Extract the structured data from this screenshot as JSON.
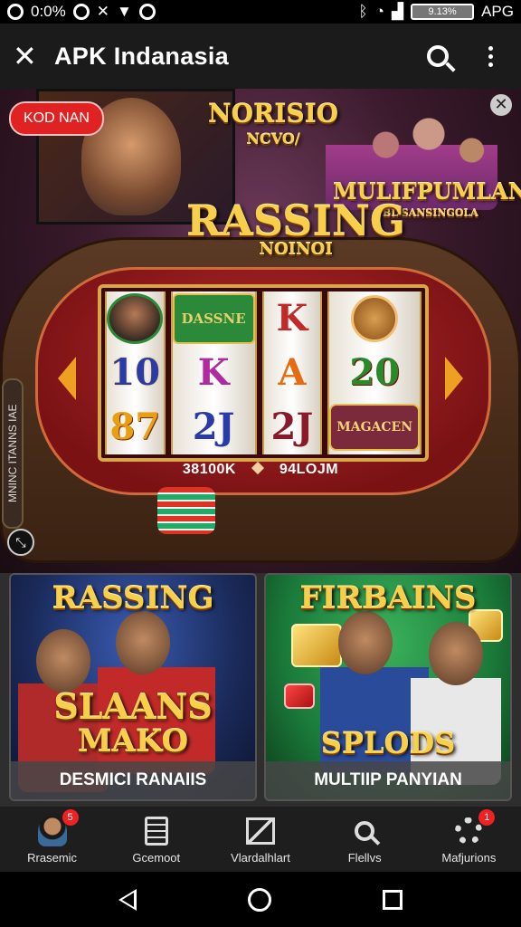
{
  "status_bar": {
    "left_text": "0:0%",
    "battery": "9.13%",
    "carrier": "APG"
  },
  "app_bar": {
    "title": "APK Indanasia",
    "icons": [
      "close-icon",
      "search-icon",
      "more-vert-icon"
    ]
  },
  "hero": {
    "badge": "KOD NAN",
    "logo_top": "NORISIO",
    "logo_top_sub": "NCVO/",
    "logo_right": "MULIFPUMLAN",
    "logo_right_sub": "BL SANSINGOLA",
    "logo_main": "RASSING",
    "logo_main_sub": "NOINOI",
    "side_label": "MNINC ITANNS IAE",
    "reels": [
      [
        "face",
        "10",
        "87"
      ],
      [
        "DASSNE",
        "K",
        "2J"
      ],
      [
        "K",
        "A",
        "2J"
      ],
      [
        "chip",
        "20",
        "MAGACEN"
      ]
    ],
    "readout_left": "38100K",
    "readout_right": "94LOJM"
  },
  "promo_cards": [
    {
      "header": "RASSING",
      "big_line_1": "SLAANS",
      "big_line_2": "MAKO",
      "caption": "DESMICI RANAIIS"
    },
    {
      "header": "FIRBAINS",
      "big_line_1": "SPLODS",
      "caption": "MULTIIP PANYIAN"
    }
  ],
  "bottom_nav": [
    {
      "label": "Rrasemic",
      "icon": "avatar-icon",
      "badge": "5"
    },
    {
      "label": "Gcemoot",
      "icon": "document-icon",
      "badge": ""
    },
    {
      "label": "Vlardalhlart",
      "icon": "map-icon",
      "badge": ""
    },
    {
      "label": "Flellvs",
      "icon": "search-icon",
      "badge": ""
    },
    {
      "label": "Mafjurions",
      "icon": "gear-icon",
      "badge": "1"
    }
  ],
  "system_nav": [
    "back-icon",
    "home-icon",
    "recents-icon"
  ]
}
